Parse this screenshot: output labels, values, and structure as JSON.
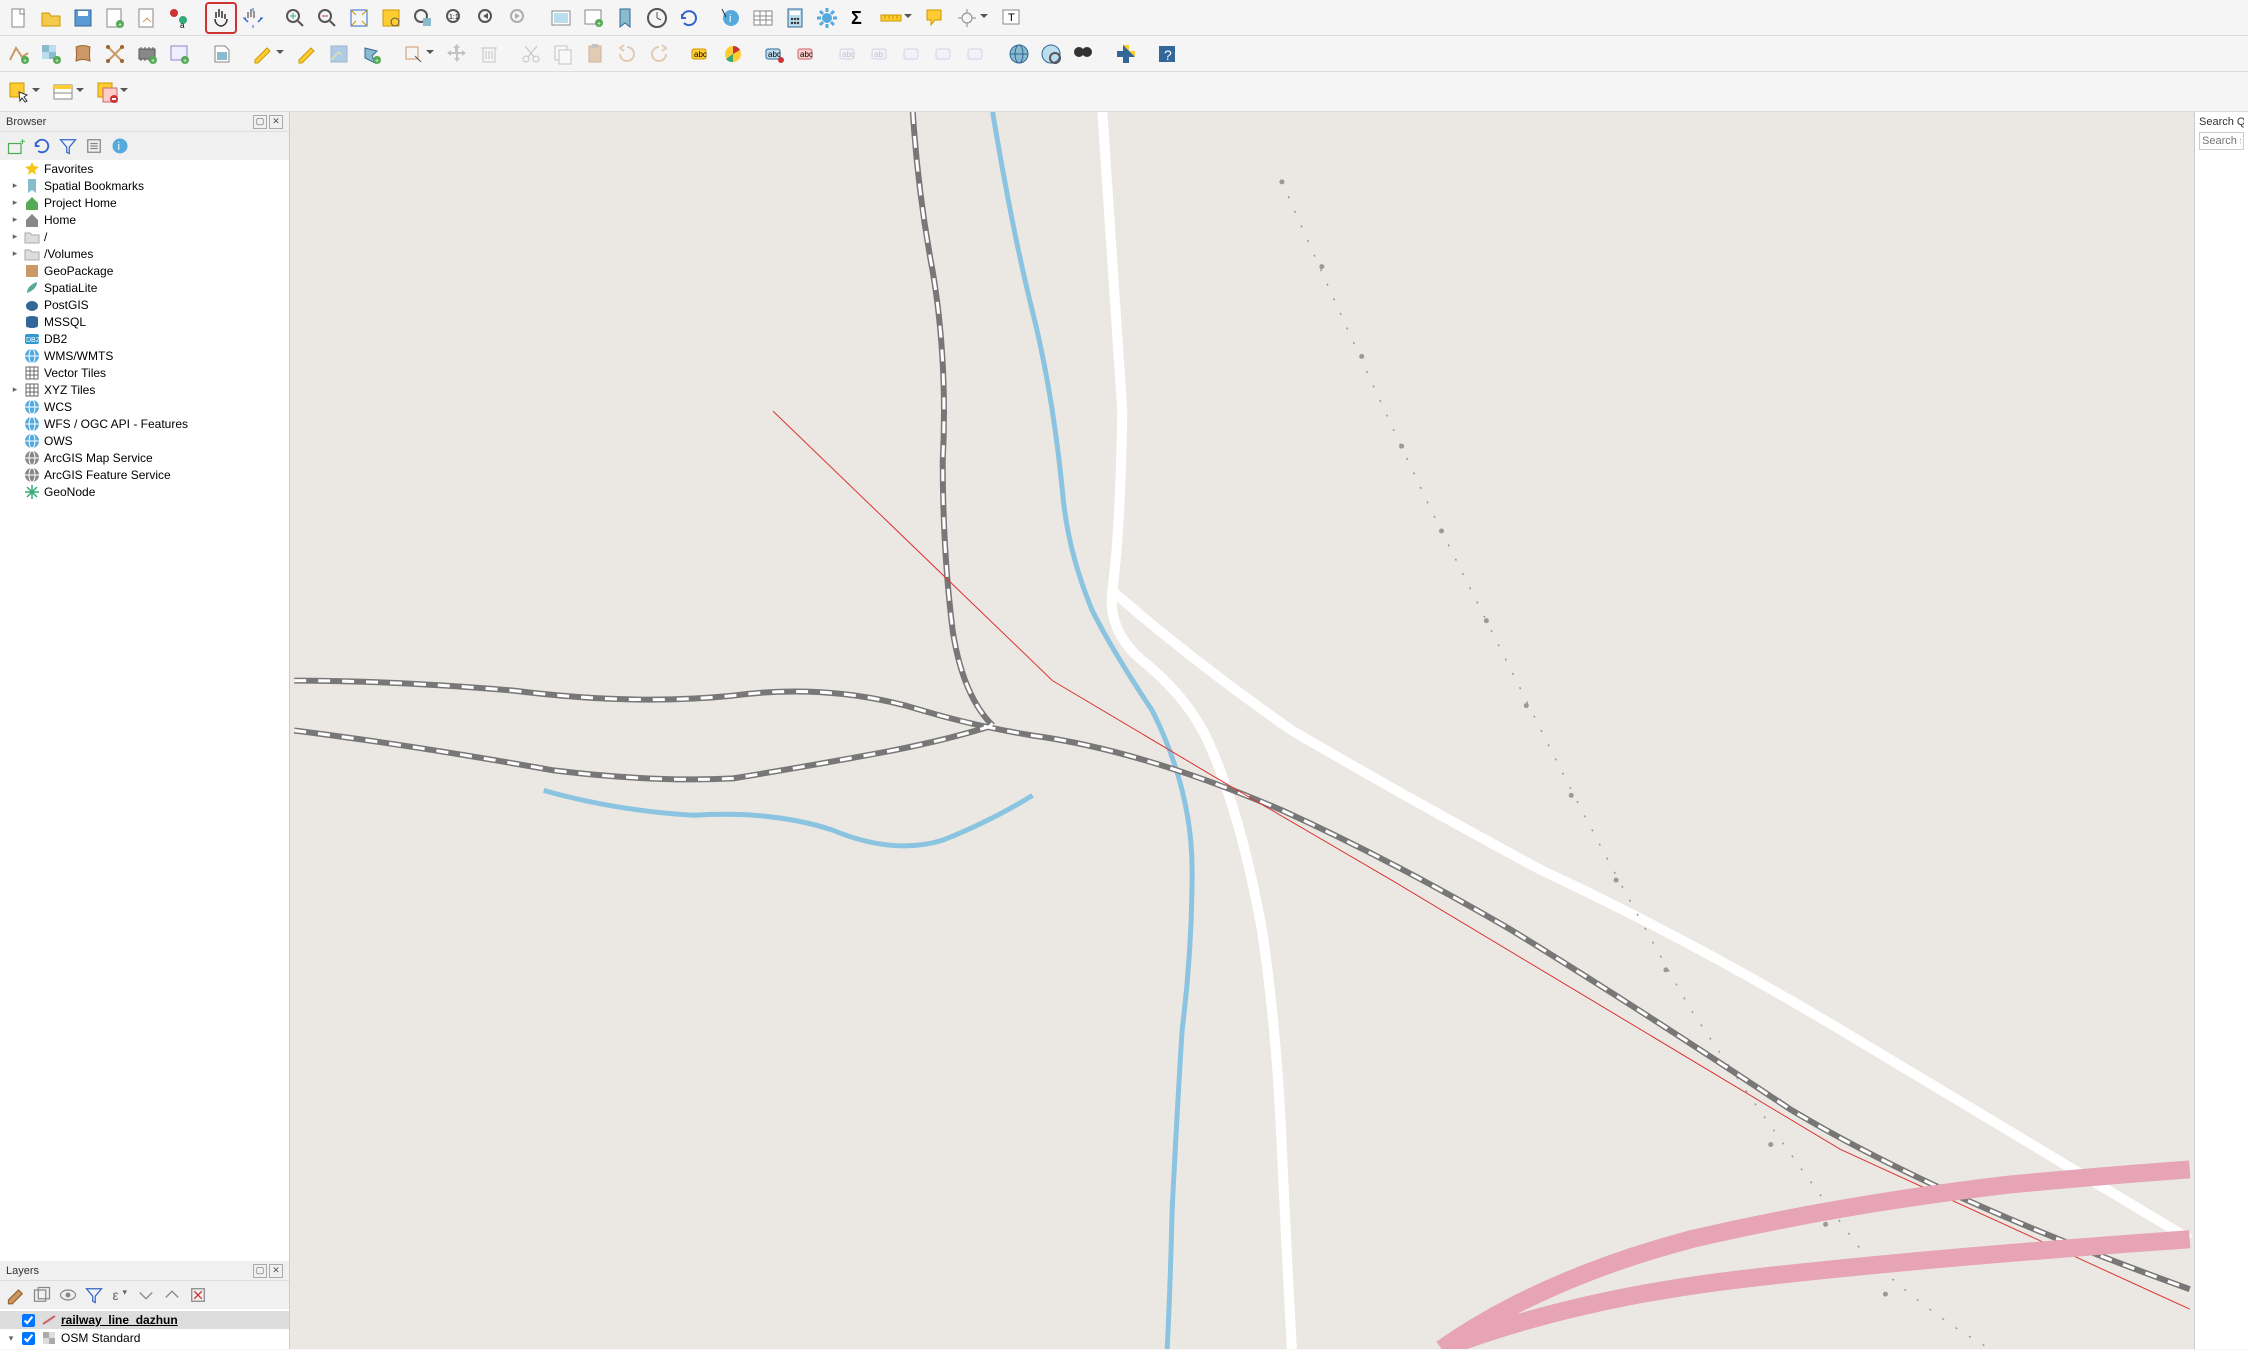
{
  "toolbar1": {
    "items": [
      {
        "name": "new-project-icon",
        "title": "New"
      },
      {
        "name": "open-project-icon",
        "title": "Open"
      },
      {
        "name": "save-project-icon",
        "title": "Save"
      },
      {
        "name": "new-print-layout-icon",
        "title": "New Print Layout"
      },
      {
        "name": "show-layout-manager-icon",
        "title": "Layout Manager"
      },
      {
        "name": "style-manager-icon",
        "title": "Style Manager"
      },
      {
        "sep": true
      },
      {
        "name": "pan-map-icon",
        "title": "Pan Map",
        "highlight": true
      },
      {
        "name": "pan-to-selection-icon",
        "title": "Pan to Selection"
      },
      {
        "sep": true
      },
      {
        "name": "zoom-in-icon",
        "title": "Zoom In"
      },
      {
        "name": "zoom-out-icon",
        "title": "Zoom Out"
      },
      {
        "name": "zoom-full-icon",
        "title": "Zoom Full"
      },
      {
        "name": "zoom-selection-icon",
        "title": "Zoom to Selection"
      },
      {
        "name": "zoom-layer-icon",
        "title": "Zoom to Layer"
      },
      {
        "name": "zoom-native-icon",
        "title": "Zoom Native"
      },
      {
        "name": "zoom-last-icon",
        "title": "Zoom Last"
      },
      {
        "name": "zoom-next-icon",
        "title": "Zoom Next",
        "disabled": true
      },
      {
        "sep": true
      },
      {
        "name": "new-map-view-icon",
        "title": "New Map View"
      },
      {
        "name": "new-bookmark-icon",
        "title": "New Bookmark"
      },
      {
        "name": "show-bookmarks-icon",
        "title": "Show Bookmarks"
      },
      {
        "name": "temporal-controller-icon",
        "title": "Temporal Controller"
      },
      {
        "name": "refresh-icon",
        "title": "Refresh"
      },
      {
        "sep": true
      },
      {
        "name": "identify-icon",
        "title": "Identify"
      },
      {
        "name": "attribute-table-icon",
        "title": "Attribute Table"
      },
      {
        "name": "field-calculator-icon",
        "title": "Field Calculator"
      },
      {
        "name": "toolbox-icon",
        "title": "Toolbox"
      },
      {
        "name": "statistics-icon",
        "title": "Statistics"
      },
      {
        "name": "measure-icon",
        "title": "Measure",
        "dd": true
      },
      {
        "name": "map-tips-icon",
        "title": "Map Tips"
      },
      {
        "name": "annotation-icon",
        "title": "Annotation",
        "dd": true
      },
      {
        "name": "text-annotation-icon",
        "title": "Text Annotation"
      }
    ]
  },
  "toolbar2": {
    "items": [
      {
        "name": "add-vector-icon",
        "title": "Add Vector"
      },
      {
        "name": "add-raster-icon",
        "title": "Add Raster"
      },
      {
        "name": "new-shapefile-icon",
        "title": "New Shapefile"
      },
      {
        "name": "new-spatialite-icon",
        "title": "New SpatiaLite"
      },
      {
        "name": "new-memory-icon",
        "title": "New Memory"
      },
      {
        "name": "new-virtual-icon",
        "title": "New Virtual"
      },
      {
        "sep": true
      },
      {
        "name": "new-gpkg-icon",
        "title": "New GeoPackage"
      },
      {
        "sep": true
      },
      {
        "name": "current-edits-icon",
        "title": "Current Edits",
        "dd": true
      },
      {
        "name": "toggle-editing-icon",
        "title": "Toggle Editing"
      },
      {
        "name": "save-edits-icon",
        "title": "Save Edits",
        "disabled": true
      },
      {
        "name": "add-feature-icon",
        "title": "Add Feature"
      },
      {
        "sep": true
      },
      {
        "name": "digitize-shape-icon",
        "title": "Digitize",
        "dd": true
      },
      {
        "name": "move-feature-icon",
        "title": "Move Feature",
        "disabled": true
      },
      {
        "name": "delete-selected-icon",
        "title": "Delete",
        "disabled": true
      },
      {
        "sep": true
      },
      {
        "name": "cut-features-icon",
        "title": "Cut",
        "disabled": true
      },
      {
        "name": "copy-features-icon",
        "title": "Copy",
        "disabled": true
      },
      {
        "name": "paste-features-icon",
        "title": "Paste",
        "disabled": true
      },
      {
        "name": "undo-icon",
        "title": "Undo",
        "disabled": true
      },
      {
        "name": "redo-icon",
        "title": "Redo",
        "disabled": true
      },
      {
        "sep": true
      },
      {
        "name": "label-tool-icon",
        "title": "Label"
      },
      {
        "name": "diagram-icon",
        "title": "Diagram"
      },
      {
        "sep": true
      },
      {
        "name": "highlight-pinned-icon",
        "title": "Highlight Pinned"
      },
      {
        "name": "pin-labels-icon",
        "title": "Pin Labels"
      },
      {
        "sep": true
      },
      {
        "name": "show-hide-icon",
        "title": "Show/Hide",
        "disabled": true
      },
      {
        "name": "move-label-icon",
        "title": "Move Label",
        "disabled": true
      },
      {
        "name": "rotate-label-icon",
        "title": "Rotate Label",
        "disabled": true
      },
      {
        "name": "change-label-icon",
        "title": "Change Label",
        "disabled": true
      },
      {
        "name": "change-label2-icon",
        "title": "Change",
        "disabled": true
      },
      {
        "sep": true
      },
      {
        "name": "osm-place-search-icon",
        "title": "OSM Place"
      },
      {
        "name": "quickosm-icon",
        "title": "QuickOSM"
      },
      {
        "name": "nominatim-icon",
        "title": "Nominatim"
      },
      {
        "sep": true
      },
      {
        "name": "python-icon",
        "title": "Python Console"
      },
      {
        "sep": true
      },
      {
        "name": "help-icon",
        "title": "Help"
      }
    ]
  },
  "toolbar3": {
    "items": [
      {
        "name": "select-features-icon",
        "title": "Select Features",
        "dd": true
      },
      {
        "name": "select-by-value-icon",
        "title": "Select by Value",
        "dd": true
      },
      {
        "name": "deselect-all-icon",
        "title": "Deselect",
        "dd": true
      }
    ]
  },
  "browser": {
    "title": "Browser",
    "items": [
      {
        "icon": "star",
        "label": "Favorites",
        "exp": false,
        "color": "#f5c518"
      },
      {
        "icon": "bookmark",
        "label": "Spatial Bookmarks",
        "exp": true,
        "color": "#8bc"
      },
      {
        "icon": "home",
        "label": "Project Home",
        "exp": true,
        "color": "#5a5"
      },
      {
        "icon": "home",
        "label": "Home",
        "exp": true,
        "color": "#888"
      },
      {
        "icon": "folder",
        "label": "/",
        "exp": true,
        "color": "#ddd"
      },
      {
        "icon": "folder",
        "label": "/Volumes",
        "exp": true,
        "color": "#ddd"
      },
      {
        "icon": "gpkg",
        "label": "GeoPackage",
        "exp": false,
        "color": "#c96"
      },
      {
        "icon": "feather",
        "label": "SpatiaLite",
        "exp": false,
        "color": "#5a9"
      },
      {
        "icon": "elephant",
        "label": "PostGIS",
        "exp": false,
        "color": "#369"
      },
      {
        "icon": "db",
        "label": "MSSQL",
        "exp": false,
        "color": "#369"
      },
      {
        "icon": "db2",
        "label": "DB2",
        "exp": false,
        "color": "#39c"
      },
      {
        "icon": "globe",
        "label": "WMS/WMTS",
        "exp": false,
        "color": "#5ad"
      },
      {
        "icon": "grid",
        "label": "Vector Tiles",
        "exp": false,
        "color": "#666"
      },
      {
        "icon": "grid",
        "label": "XYZ Tiles",
        "exp": true,
        "color": "#666"
      },
      {
        "icon": "globe",
        "label": "WCS",
        "exp": false,
        "color": "#5ad"
      },
      {
        "icon": "globe",
        "label": "WFS / OGC API - Features",
        "exp": false,
        "color": "#5ad"
      },
      {
        "icon": "globe",
        "label": "OWS",
        "exp": false,
        "color": "#5ad"
      },
      {
        "icon": "globe",
        "label": "ArcGIS Map Service",
        "exp": false,
        "color": "#888"
      },
      {
        "icon": "globe",
        "label": "ArcGIS Feature Service",
        "exp": false,
        "color": "#888"
      },
      {
        "icon": "snow",
        "label": "GeoNode",
        "exp": false,
        "color": "#3a7"
      }
    ]
  },
  "layers": {
    "title": "Layers",
    "items": [
      {
        "checked": true,
        "name": "railway_line_dazhun",
        "active": true,
        "icon": "line",
        "color": "#c66"
      },
      {
        "checked": true,
        "name": "OSM Standard",
        "active": false,
        "icon": "raster",
        "color": "#888",
        "exp": true
      }
    ]
  },
  "right": {
    "search_label": "Search QM",
    "placeholder": "Search s"
  }
}
